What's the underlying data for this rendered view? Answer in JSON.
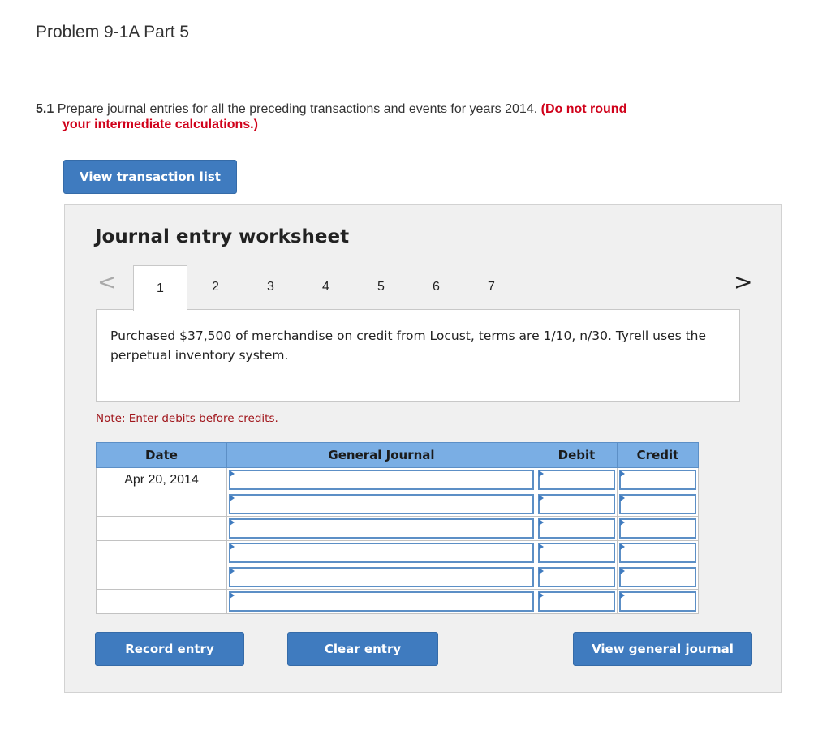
{
  "page": {
    "title": "Problem 9-1A Part 5"
  },
  "instructions": {
    "number": "5.1",
    "text": "Prepare journal entries for all the preceding transactions and events for years 2014.",
    "warning_line1": "(Do not round",
    "warning_line2": "your intermediate calculations.)"
  },
  "buttons": {
    "view_transaction_list": "View transaction list",
    "record_entry": "Record entry",
    "clear_entry": "Clear entry",
    "view_general_journal": "View general journal"
  },
  "worksheet": {
    "heading": "Journal entry worksheet",
    "prev_arrow": "<",
    "next_arrow": ">",
    "tabs": [
      {
        "label": "1",
        "active": true
      },
      {
        "label": "2",
        "active": false
      },
      {
        "label": "3",
        "active": false
      },
      {
        "label": "4",
        "active": false
      },
      {
        "label": "5",
        "active": false
      },
      {
        "label": "6",
        "active": false
      },
      {
        "label": "7",
        "active": false
      }
    ],
    "description": "Purchased $37,500 of merchandise on credit from Locust, terms are 1/10, n/30. Tyrell uses the perpetual inventory system.",
    "note": "Note: Enter debits before credits."
  },
  "journal": {
    "headers": {
      "date": "Date",
      "general_journal": "General Journal",
      "debit": "Debit",
      "credit": "Credit"
    },
    "rows": [
      {
        "date": "Apr 20, 2014",
        "account": "",
        "debit": "",
        "credit": ""
      },
      {
        "date": "",
        "account": "",
        "debit": "",
        "credit": ""
      },
      {
        "date": "",
        "account": "",
        "debit": "",
        "credit": ""
      },
      {
        "date": "",
        "account": "",
        "debit": "",
        "credit": ""
      },
      {
        "date": "",
        "account": "",
        "debit": "",
        "credit": ""
      },
      {
        "date": "",
        "account": "",
        "debit": "",
        "credit": ""
      }
    ]
  },
  "colors": {
    "button_blue": "#3f7bbf",
    "header_blue": "#7aaee4",
    "warning_red": "#d0021b",
    "note_red": "#a0151b"
  }
}
